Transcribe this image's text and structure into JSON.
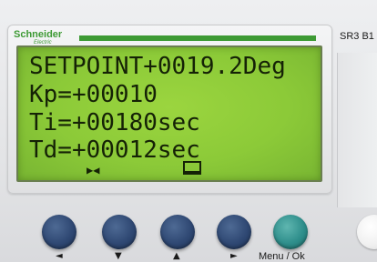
{
  "brand": {
    "name": "Schneider",
    "sub": "Electric",
    "color": "#3d9a34"
  },
  "model_label": "SR3 B1",
  "lcd": {
    "background": "#8cca38",
    "text_color": "#152206",
    "lines": [
      "SETPOINT+0019.2Deg",
      "Kp=+00010",
      "Ti=+00180sec",
      "Td=+00012sec"
    ],
    "icons": [
      "bowtie-icon",
      "monitor-icon"
    ]
  },
  "buttons": [
    {
      "name": "left-button",
      "arrow": "◄",
      "color": "#2f4873"
    },
    {
      "name": "down-button",
      "arrow": "▼",
      "color": "#2f4873"
    },
    {
      "name": "up-button",
      "arrow": "▲",
      "color": "#2f4873"
    },
    {
      "name": "right-button",
      "arrow": "►",
      "color": "#2f4873"
    },
    {
      "name": "menu-ok-button",
      "label": "Menu / Ok",
      "color": "#2e8e8b"
    }
  ]
}
